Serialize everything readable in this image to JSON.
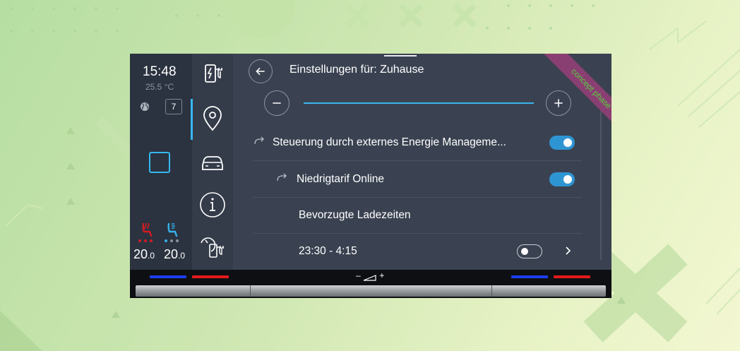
{
  "status": {
    "time": "15:48",
    "outside_temp": "25.5 °C",
    "notification_count": "7",
    "climate_left": {
      "value": "20.0",
      "main": "20",
      "decimal": ".0"
    },
    "climate_right": {
      "value": "20.0",
      "main": "20",
      "decimal": ".0"
    }
  },
  "header": {
    "title": "Einstellungen für: Zuhause",
    "badge": "concept phase"
  },
  "rows": [
    {
      "label": "Steuerung durch externes Energie Manageme...",
      "toggle": "on"
    },
    {
      "label": "Niedrigtarif Online",
      "toggle": "on"
    },
    {
      "label": "Bevorzugte Ladezeiten"
    },
    {
      "label": "23:30 - 4:15",
      "toggle": "off"
    }
  ],
  "bottom": {
    "volume_minus": "–",
    "volume_plus": "+"
  },
  "colors": {
    "accent": "#36b7f0",
    "background": "#3a4251",
    "ribbon": "#8a3f73",
    "ribbon_text": "#54d23c",
    "heat_left": "#d21c24",
    "cool_right": "#35b2ea"
  },
  "icons": [
    "charging-station-icon",
    "location-pin-icon",
    "car-icon",
    "info-icon",
    "charging-timer-icon",
    "globe-icon",
    "back-arrow-icon",
    "minus-icon",
    "plus-icon",
    "redirect-arrow-icon",
    "chevron-right-icon",
    "seat-heating-icon",
    "seat-ventilation-icon"
  ]
}
